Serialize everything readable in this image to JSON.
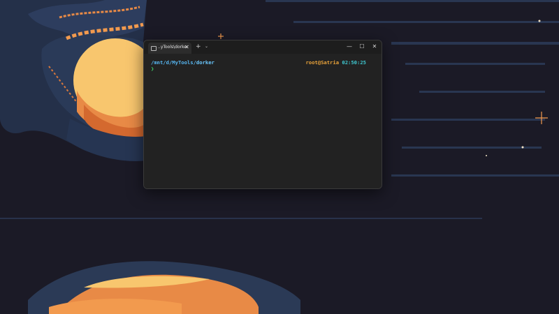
{
  "terminal": {
    "tab_title": "..yTools\\dorker",
    "tab_close": "✕",
    "new_tab": "+",
    "tab_dropdown": "⌄",
    "window_controls": {
      "minimize": "—",
      "maximize": "☐",
      "close": "✕"
    },
    "path_prefix": "/mnt/d/MyTools/",
    "path_last": "dorker",
    "user_host": "root@Satria",
    "time": "02:50:25",
    "prompt_char": "❯",
    "icons": {
      "tab": "terminal-icon"
    }
  },
  "colors": {
    "path": "#56b6f2",
    "user": "#e8a23a",
    "time": "#3fc9d2",
    "prompt": "#3fd96b",
    "wallpaper_sky": "#1b1a26",
    "wallpaper_cloud": "#2b3a56",
    "wallpaper_moon": "#f8c66e"
  }
}
